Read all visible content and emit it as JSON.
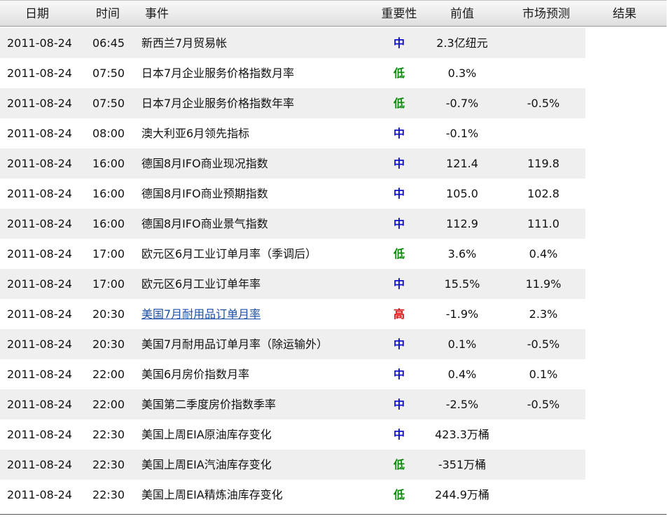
{
  "header": {
    "date": "日期",
    "time": "时间",
    "event": "事件",
    "importance": "重要性",
    "previous": "前值",
    "forecast": "市场预测",
    "result": "结果"
  },
  "importance_colors": {
    "中": "#1010cc",
    "低": "#0b8a0b",
    "高": "#dd1111"
  },
  "rows": [
    {
      "date": "2011-08-24",
      "time": "06:45",
      "event": "新西兰7月贸易帐",
      "importance": "中",
      "previous": "2.3亿纽元",
      "forecast": "",
      "result": "",
      "link": false
    },
    {
      "date": "2011-08-24",
      "time": "07:50",
      "event": "日本7月企业服务价格指数月率",
      "importance": "低",
      "previous": "0.3%",
      "forecast": "",
      "result": "",
      "link": false
    },
    {
      "date": "2011-08-24",
      "time": "07:50",
      "event": "日本7月企业服务价格指数年率",
      "importance": "低",
      "previous": "-0.7%",
      "forecast": "-0.5%",
      "result": "",
      "link": false
    },
    {
      "date": "2011-08-24",
      "time": "08:00",
      "event": "澳大利亚6月领先指标",
      "importance": "中",
      "previous": "-0.1%",
      "forecast": "",
      "result": "",
      "link": false
    },
    {
      "date": "2011-08-24",
      "time": "16:00",
      "event": "德国8月IFO商业现况指数",
      "importance": "中",
      "previous": "121.4",
      "forecast": "119.8",
      "result": "",
      "link": false
    },
    {
      "date": "2011-08-24",
      "time": "16:00",
      "event": "德国8月IFO商业预期指数",
      "importance": "中",
      "previous": "105.0",
      "forecast": "102.8",
      "result": "",
      "link": false
    },
    {
      "date": "2011-08-24",
      "time": "16:00",
      "event": "德国8月IFO商业景气指数",
      "importance": "中",
      "previous": "112.9",
      "forecast": "111.0",
      "result": "",
      "link": false
    },
    {
      "date": "2011-08-24",
      "time": "17:00",
      "event": "欧元区6月工业订单月率（季调后）",
      "importance": "低",
      "previous": "3.6%",
      "forecast": "0.4%",
      "result": "",
      "link": false
    },
    {
      "date": "2011-08-24",
      "time": "17:00",
      "event": "欧元区6月工业订单年率",
      "importance": "中",
      "previous": "15.5%",
      "forecast": "11.9%",
      "result": "",
      "link": false
    },
    {
      "date": "2011-08-24",
      "time": "20:30",
      "event": "美国7月耐用品订单月率",
      "importance": "高",
      "previous": "-1.9%",
      "forecast": "2.3%",
      "result": "",
      "link": true
    },
    {
      "date": "2011-08-24",
      "time": "20:30",
      "event": "美国7月耐用品订单月率（除运输外）",
      "importance": "中",
      "previous": "0.1%",
      "forecast": "-0.5%",
      "result": "",
      "link": false
    },
    {
      "date": "2011-08-24",
      "time": "22:00",
      "event": "美国6月房价指数月率",
      "importance": "中",
      "previous": "0.4%",
      "forecast": "0.1%",
      "result": "",
      "link": false
    },
    {
      "date": "2011-08-24",
      "time": "22:00",
      "event": "美国第二季度房价指数季率",
      "importance": "中",
      "previous": "-2.5%",
      "forecast": "-0.5%",
      "result": "",
      "link": false
    },
    {
      "date": "2011-08-24",
      "time": "22:30",
      "event": "美国上周EIA原油库存变化",
      "importance": "中",
      "previous": "423.3万桶",
      "forecast": "",
      "result": "",
      "link": false
    },
    {
      "date": "2011-08-24",
      "time": "22:30",
      "event": "美国上周EIA汽油库存变化",
      "importance": "低",
      "previous": "-351万桶",
      "forecast": "",
      "result": "",
      "link": false
    },
    {
      "date": "2011-08-24",
      "time": "22:30",
      "event": "美国上周EIA精炼油库存变化",
      "importance": "低",
      "previous": "244.9万桶",
      "forecast": "",
      "result": "",
      "link": false
    }
  ]
}
